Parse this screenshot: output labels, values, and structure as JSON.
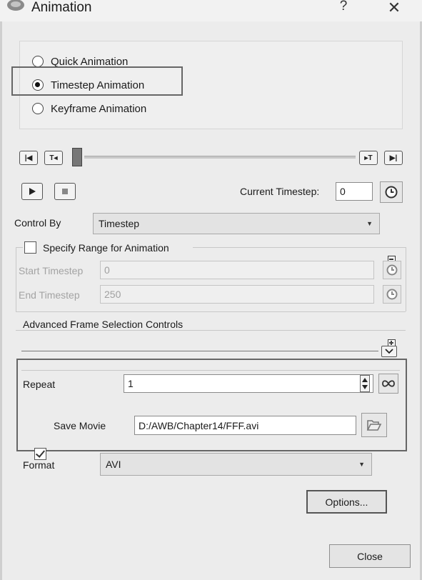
{
  "window": {
    "title": "Animation",
    "help": "?",
    "close": "✕"
  },
  "animation_mode": {
    "options": [
      {
        "label": "Quick Animation",
        "selected": false
      },
      {
        "label": "Timestep Animation",
        "selected": true
      },
      {
        "label": "Keyframe Animation",
        "selected": false
      }
    ]
  },
  "playback": {
    "first_label": "|◀",
    "step_back_label": "T◂",
    "step_forward_label": "▸T",
    "last_label": "▶|",
    "current_timestep_label": "Current Timestep:",
    "current_timestep_value": "0"
  },
  "control": {
    "control_by_label": "Control By",
    "control_by_value": "Timestep"
  },
  "range": {
    "specify_label": "Specify Range for Animation",
    "specify_checked": false,
    "start_label": "Start Timestep",
    "start_value": "0",
    "end_label": "End Timestep",
    "end_value": "250"
  },
  "advanced": {
    "label": "Advanced Frame Selection Controls"
  },
  "movie": {
    "repeat_label": "Repeat",
    "repeat_value": "1",
    "save_movie_label": "Save Movie",
    "save_movie_checked": true,
    "save_path": "D:/AWB/Chapter14/FFF.avi",
    "format_label": "Format",
    "format_value": "AVI"
  },
  "buttons": {
    "options": "Options...",
    "close": "Close"
  }
}
